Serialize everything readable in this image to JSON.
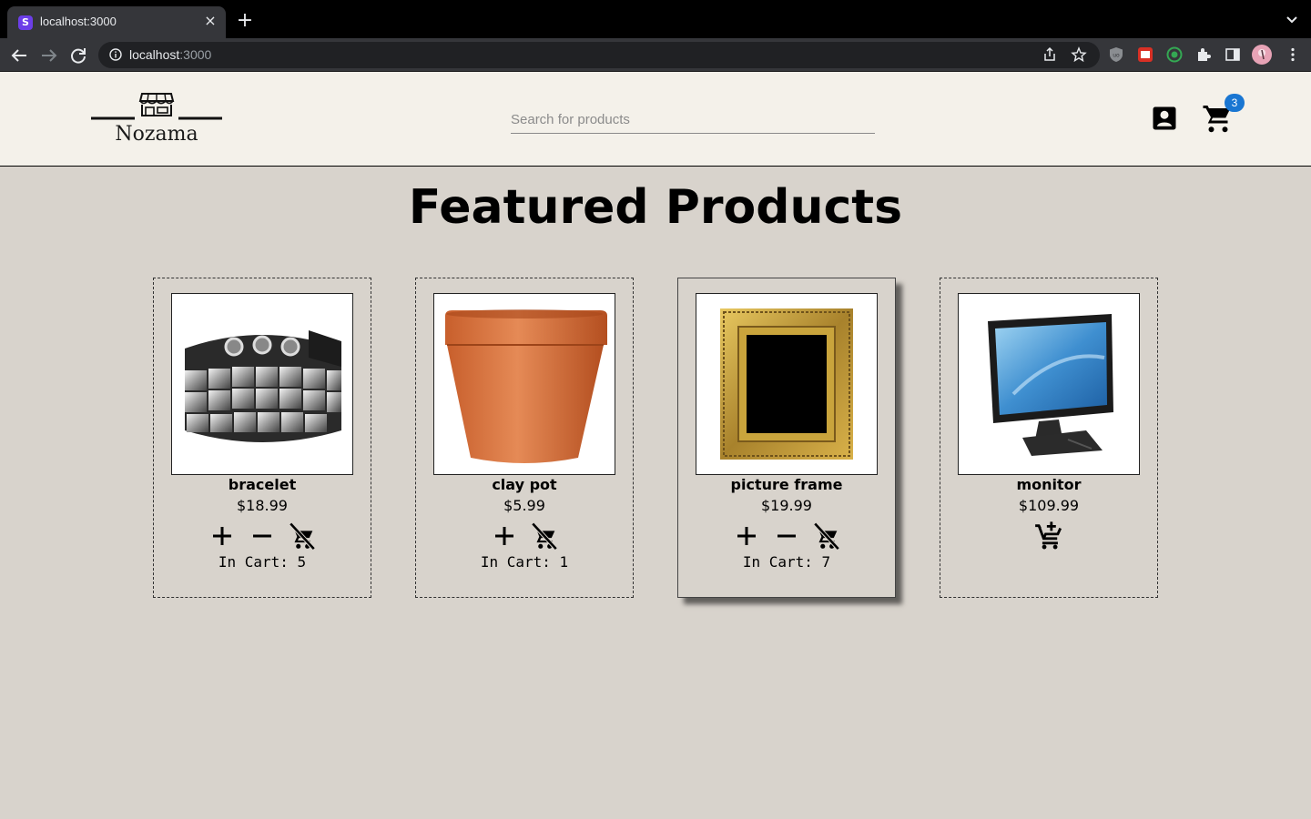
{
  "browser": {
    "tab_title": "localhost:3000",
    "tab_favicon_letter": "S",
    "url_host": "localhost",
    "url_port": ":3000"
  },
  "header": {
    "logo_text": "Nozama",
    "search_placeholder": "Search for products",
    "cart_count": "3"
  },
  "main": {
    "title": "Featured Products",
    "in_cart_prefix": "In Cart: ",
    "products": [
      {
        "name": "bracelet",
        "price": "$18.99",
        "in_cart": "In Cart: 5",
        "image": "bracelet"
      },
      {
        "name": "clay pot",
        "price": "$5.99",
        "in_cart": "In Cart: 1",
        "image": "clay-pot"
      },
      {
        "name": "picture frame",
        "price": "$19.99",
        "in_cart": "In Cart: 7",
        "image": "picture-frame"
      },
      {
        "name": "monitor",
        "price": "$109.99",
        "in_cart": "",
        "image": "monitor"
      }
    ]
  },
  "colors": {
    "page_bg": "#d8d3cc",
    "header_bg": "#f4f1ea",
    "badge": "#1976d2"
  }
}
